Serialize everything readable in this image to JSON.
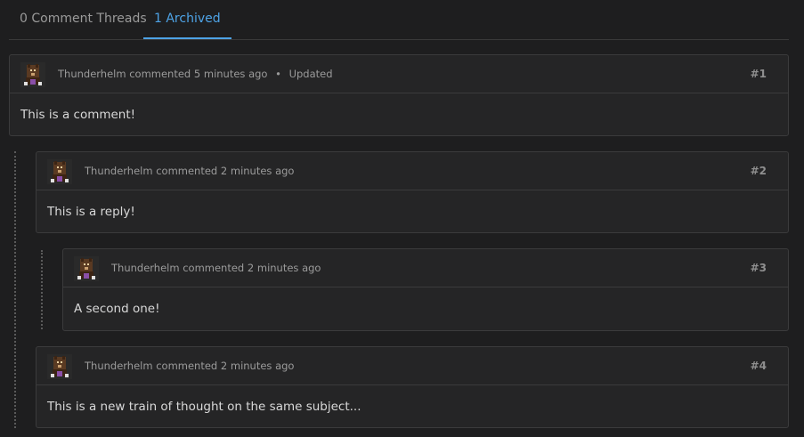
{
  "tabs": [
    {
      "label": "0 Comment Threads"
    },
    {
      "label": "1 Archived"
    }
  ],
  "comments": [
    {
      "author": "Thunderhelm",
      "action": "commented",
      "time": "5 minutes ago",
      "sep": "•",
      "status": "Updated",
      "number": "#1",
      "body": "This is a comment!"
    },
    {
      "author": "Thunderhelm",
      "action": "commented",
      "time": "2 minutes ago",
      "number": "#2",
      "body": "This is a reply!"
    },
    {
      "author": "Thunderhelm",
      "action": "commented",
      "time": "2 minutes ago",
      "number": "#3",
      "body": "A second one!"
    },
    {
      "author": "Thunderhelm",
      "action": "commented",
      "time": "2 minutes ago",
      "number": "#4",
      "body": "This is a new train of thought on the same subject..."
    }
  ]
}
